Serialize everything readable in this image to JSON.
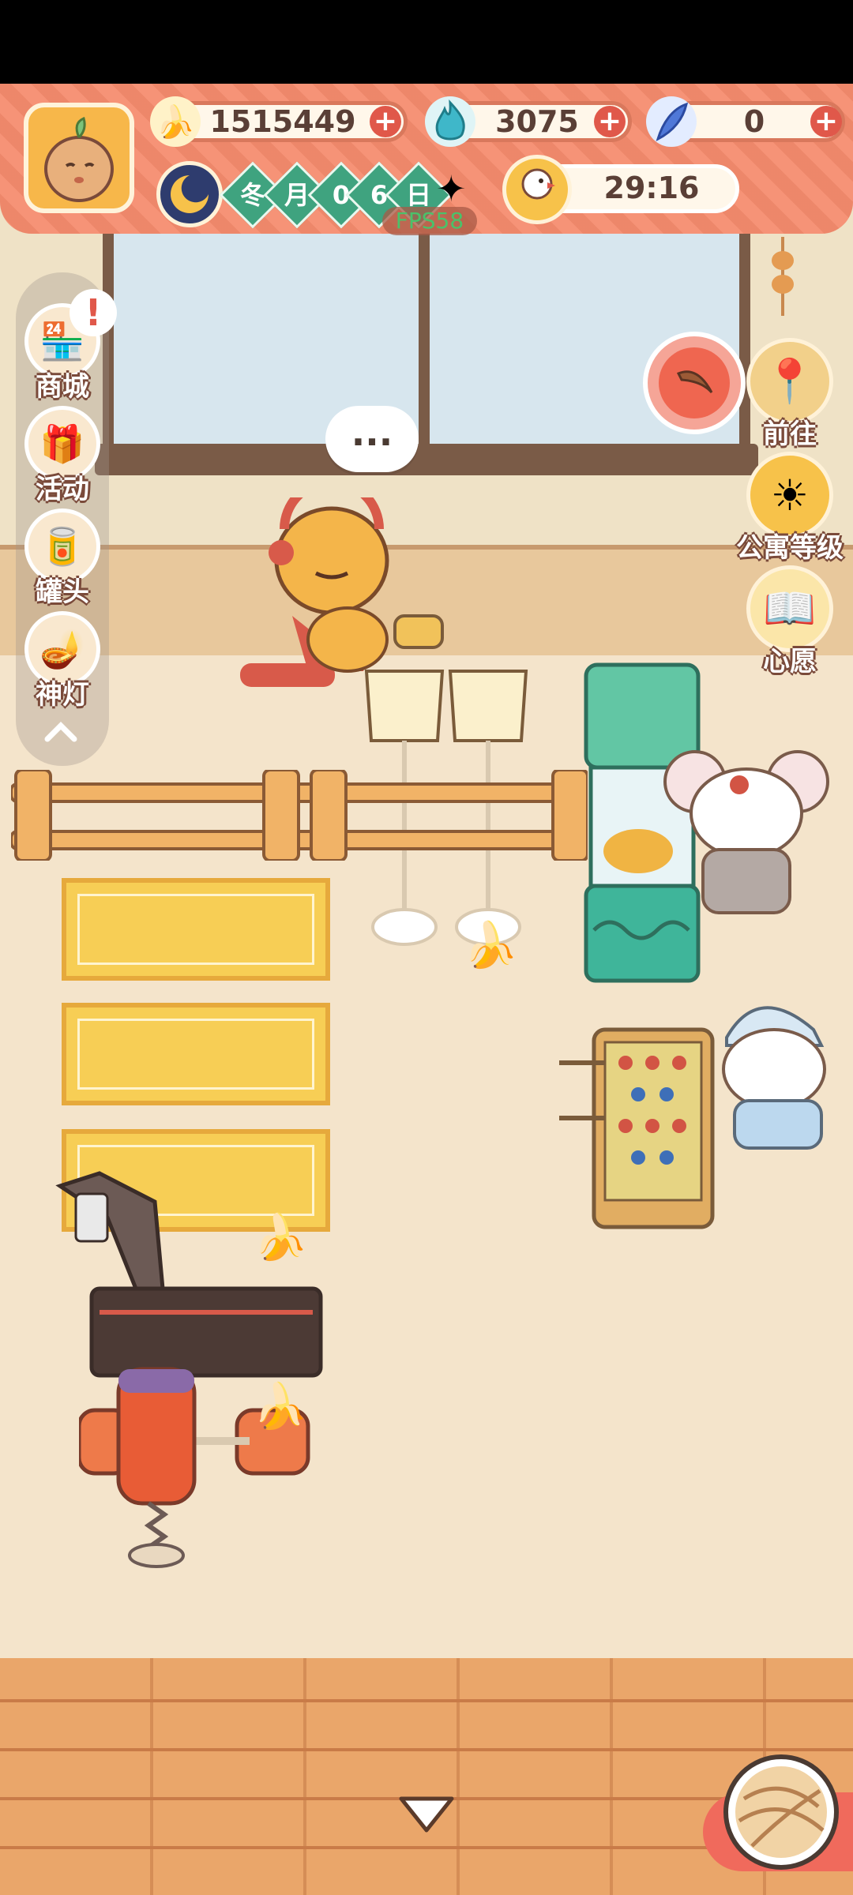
{
  "resources": {
    "banana_count": "1515449",
    "flame_count": "3075",
    "feather_count": "0"
  },
  "calendar": {
    "chars": [
      "冬",
      "月",
      "0",
      "6",
      "日"
    ]
  },
  "fps_label": "FPS58",
  "timer": "29:16",
  "speech_bubble": "...",
  "left_menu": [
    {
      "label": "商城",
      "icon": "shop-icon",
      "has_alert": true
    },
    {
      "label": "活动",
      "icon": "gift-icon",
      "has_alert": false
    },
    {
      "label": "罐头",
      "icon": "can-icon",
      "has_alert": false
    },
    {
      "label": "神灯",
      "icon": "lamp-icon",
      "has_alert": false
    }
  ],
  "right_menu": [
    {
      "label": "前往",
      "icon": "map-pin-icon"
    },
    {
      "label": "公寓等级",
      "icon": "sun-badge-icon"
    },
    {
      "label": "心愿",
      "icon": "heart-book-icon"
    }
  ],
  "alert_mark": "!",
  "colors": {
    "topbar": "#f58b6d",
    "accent_red": "#e0584a",
    "calendar_green": "#3fa37f",
    "floor": "#f4e4cb"
  }
}
